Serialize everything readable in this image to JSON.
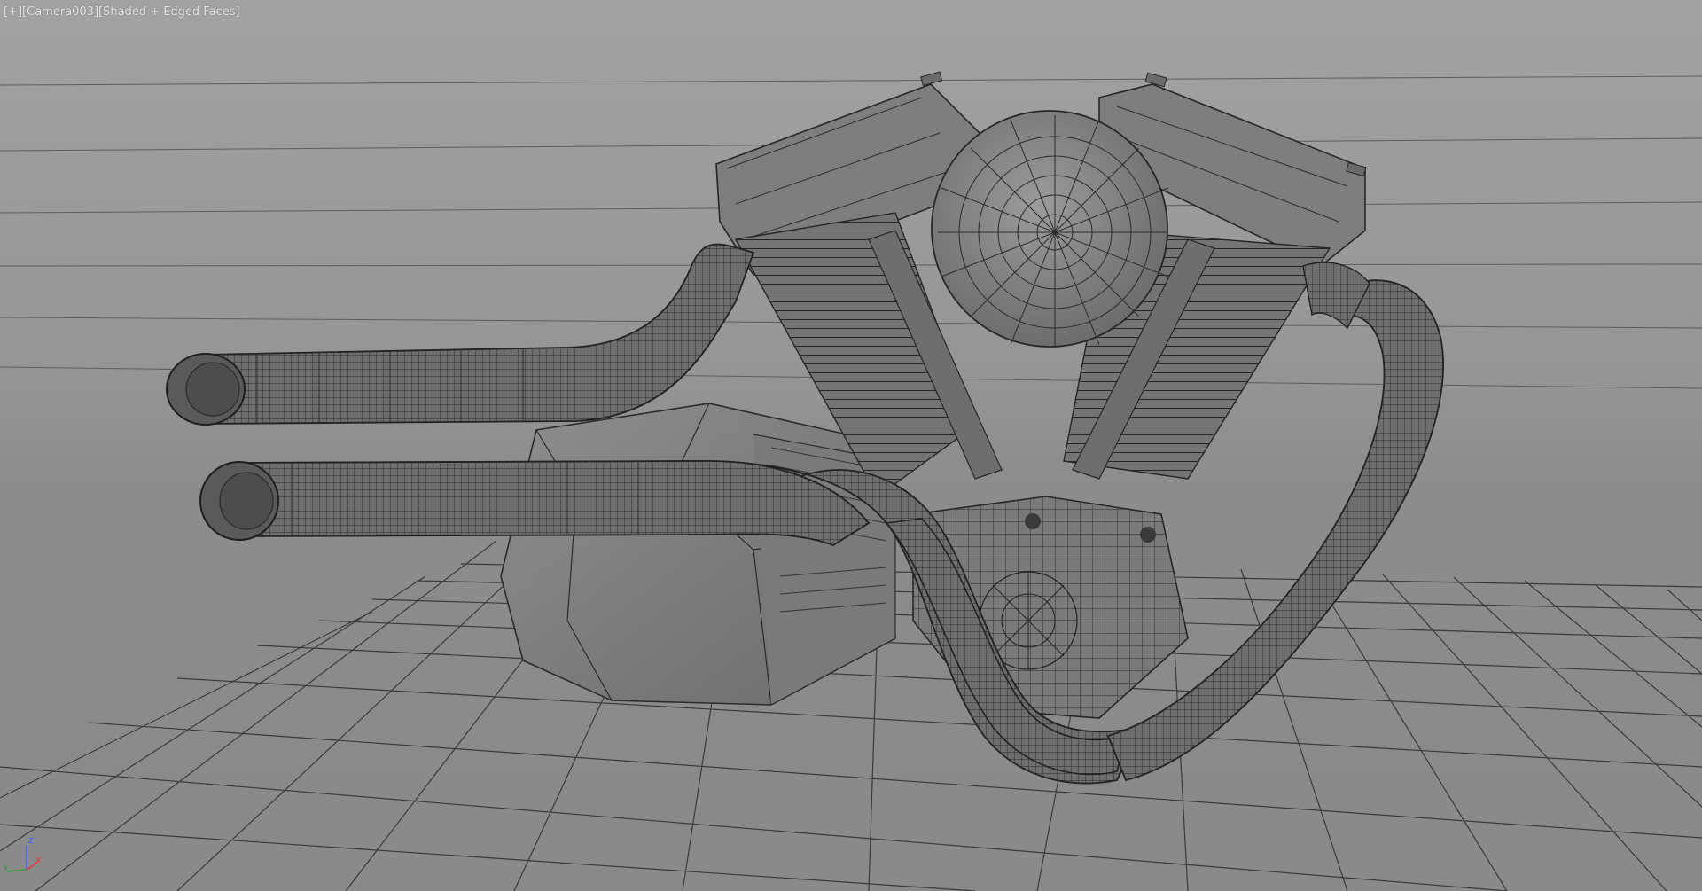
{
  "viewport": {
    "menus": [
      {
        "label": "[+]"
      },
      {
        "label": "[Camera003]"
      },
      {
        "label": "[Shaded + Edged Faces]"
      }
    ],
    "gizmo": {
      "z_label": "z",
      "y_label": "y",
      "x_label": "x",
      "colors": {
        "z": "#3d5fff",
        "y": "#3c9a3c",
        "x": "#e03a3a"
      }
    }
  },
  "scene": {
    "objects": [
      {
        "name": "ground-grid"
      },
      {
        "name": "engine-block"
      },
      {
        "name": "air-cleaner"
      },
      {
        "name": "exhaust-pipe-upper"
      },
      {
        "name": "exhaust-pipe-lower"
      },
      {
        "name": "exhaust-pipe-rear"
      },
      {
        "name": "oil-tank"
      }
    ]
  }
}
